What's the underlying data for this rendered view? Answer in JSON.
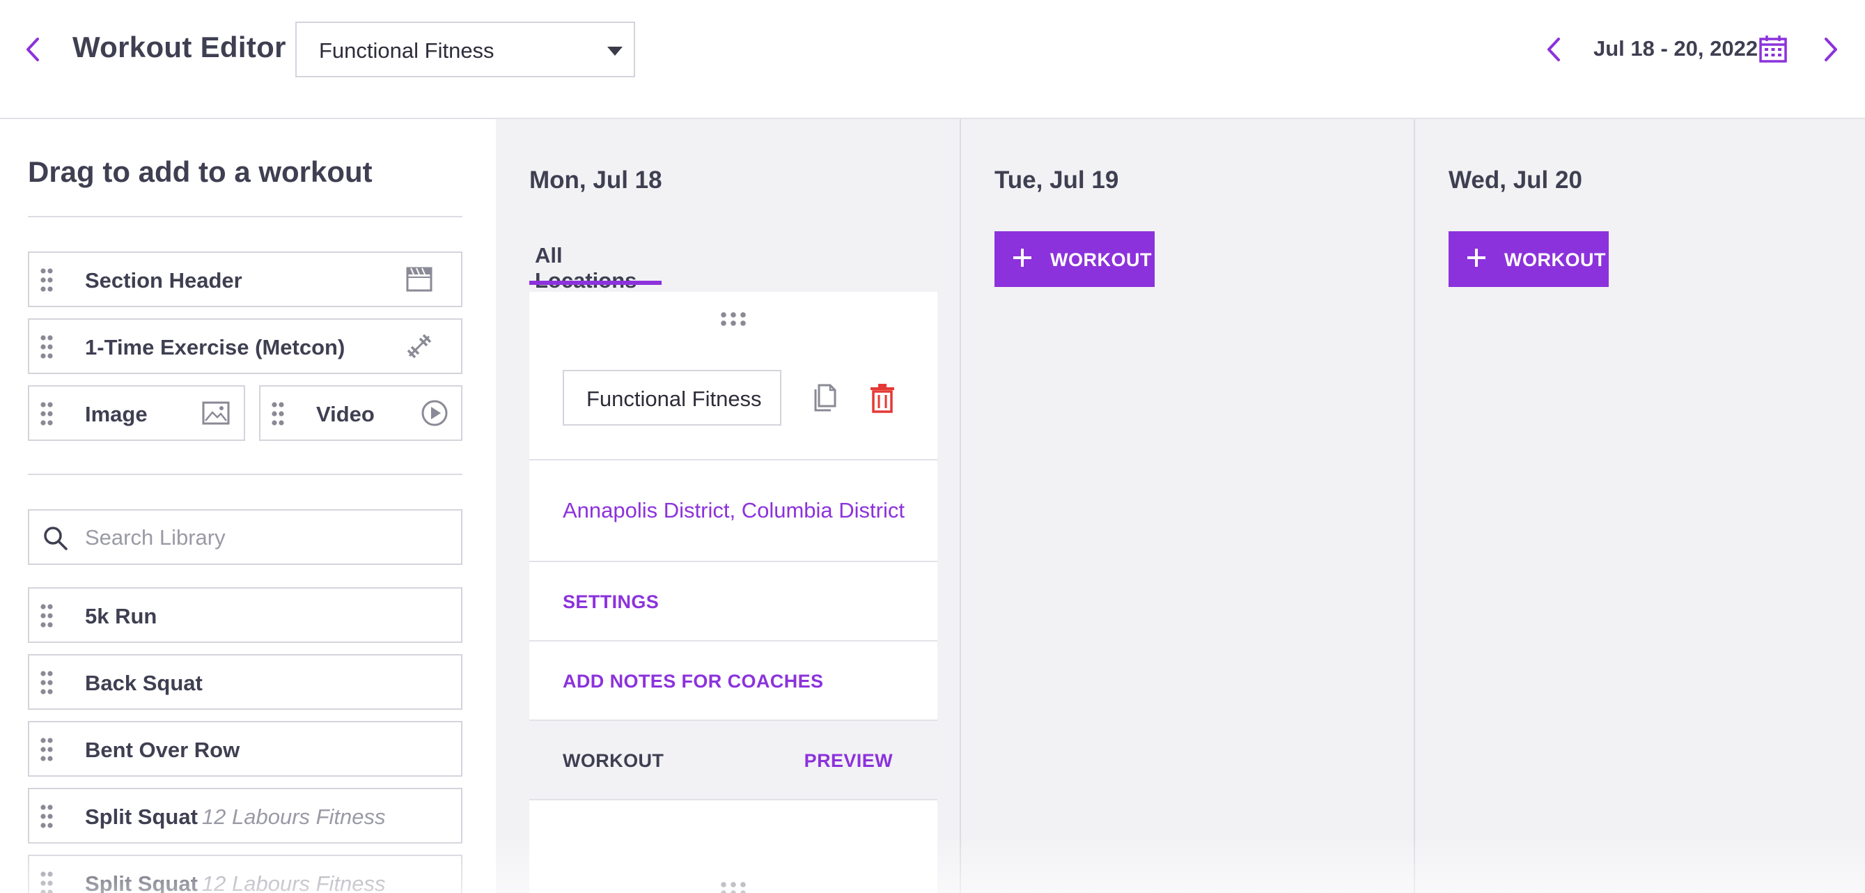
{
  "header": {
    "title": "Workout Editor",
    "program": "Functional Fitness",
    "date_range": "Jul 18 - 20, 2022"
  },
  "sidebar": {
    "title": "Drag to add to a workout",
    "blocks": [
      {
        "label": "Section Header",
        "icon": "section-header-icon"
      },
      {
        "label": "1-Time Exercise (Metcon)",
        "icon": "dumbbell-icon"
      },
      {
        "label": "Image",
        "icon": "image-icon"
      },
      {
        "label": "Video",
        "icon": "play-circle-icon"
      }
    ],
    "search": {
      "placeholder": "Search Library",
      "value": ""
    },
    "library": [
      {
        "name": "5k Run",
        "source": ""
      },
      {
        "name": "Back Squat",
        "source": ""
      },
      {
        "name": "Bent Over Row",
        "source": ""
      },
      {
        "name": "Split Squat",
        "source": "12 Labours Fitness"
      },
      {
        "name": "Split Squat",
        "source": "12 Labours Fitness"
      }
    ]
  },
  "days": [
    {
      "label": "Mon, Jul 18",
      "tab": "All Locations",
      "workout": {
        "name": "Functional Fitness",
        "locations": "Annapolis District, Columbia District",
        "settings_label": "SETTINGS",
        "notes_label": "ADD NOTES FOR COACHES",
        "workout_label": "WORKOUT",
        "preview_label": "PREVIEW"
      }
    },
    {
      "label": "Tue, Jul 19",
      "add_label": "WORKOUT"
    },
    {
      "label": "Wed, Jul 20",
      "add_label": "WORKOUT"
    }
  ],
  "colors": {
    "accent": "#8c32dc",
    "delete": "#e53935",
    "text": "#3f3f52",
    "calendar_bg": "#f2f2f5"
  }
}
